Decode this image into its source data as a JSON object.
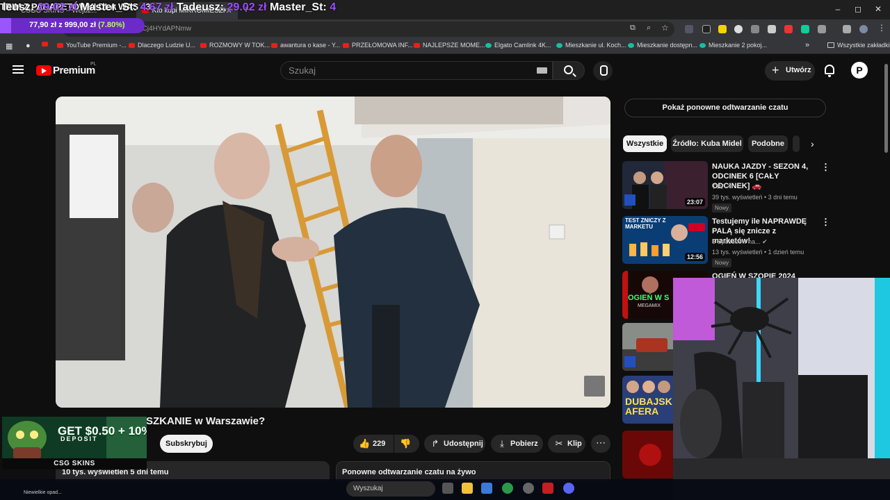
{
  "browser": {
    "tabs": [
      {
        "label": "CSGO SKINS – Wejdź...",
        "active": false
      },
      {
        "label": "Kto kupi MIKROMIESZKANIE",
        "active": true
      }
    ],
    "url": "youtube.com/watch?v=Cj4HYdAPNmw",
    "bookmarks": [
      "YouTube Premium -...",
      "Dlaczego Ludzie U...",
      "ROZMOWY W TOK...",
      "awantura o kase - Y...",
      "PRZEŁOMOWA INF...",
      "NAJLEPSZE MOME...",
      "Elgato Camlink 4K...",
      "Mieszkanie ul. Koch...",
      "Mieszkanie dostępn...",
      "Mieszkanie 2 pokoj..."
    ],
    "all_bookmarks": "Wszystkie zakładki"
  },
  "youtube": {
    "logo_text": "Premium",
    "logo_region": "PL",
    "search_placeholder": "Szukaj",
    "create_label": "Utwórz",
    "avatar_letter": "P"
  },
  "video": {
    "title_visible": "SZKANIE w Warszawie?",
    "subscribe_label": "Subskrybuj",
    "likes": "229",
    "share_label": "Udostępnij",
    "download_label": "Pobierz",
    "clip_label": "Klip",
    "views_date": "10 tys. wyświetleń  5 dni temu",
    "replay_box": "Ponowne odtwarzanie czatu na żywo"
  },
  "sidebar": {
    "chat_replay_button": "Pokaż ponowne odtwarzanie czatu",
    "chips": [
      "Wszystkie",
      "Źródło: Kuba Midel",
      "Podobne"
    ],
    "videos": [
      {
        "title": "NAUKA JAZDY - SEZON 4, ODCINEK 6 [CAŁY ODCINEK]",
        "channel": "TTV",
        "meta": "39 tys. wyświetleń • 3 dni temu",
        "badge": "Nowy",
        "duration": "23:07"
      },
      {
        "title": "Testujemy ile NAPRAWDĘ PALĄ się znicze z marketów!",
        "channel": "5 Sposobów na...",
        "meta": "13 tys. wyświetleń • 1 dzień temu",
        "badge": "Nowy",
        "duration": "12:56",
        "thumb_text": "TEST ZNICZY Z MARKETU"
      },
      {
        "title": "OGIEŃ W SZOPIE 2024 VOL.46",
        "thumb_text": "OGIEŃ W S",
        "thumb_sub": "MEGAMIX"
      },
      {
        "title": ""
      },
      {
        "title": "",
        "thumb_text": "DUBAJSK AFERA"
      },
      {
        "title": ""
      }
    ]
  },
  "overlay": {
    "top_text": "TRIM Z PARAPETÓWKI DLA WAS <3",
    "goal_text": "77,90 zł z 999,00 zł",
    "goal_pct_text": "(7.80%)",
    "goal_fraction": 0.078,
    "ad_text": "GET $0.50 + 10%",
    "ad_sub": "DEPOSIT",
    "ad_brand": "CSG SKINS",
    "ticker": [
      {
        "name": "leusz:",
        "amount": "29.02 zł"
      },
      {
        "name": "Master_St:",
        "amount": "4.67 zł"
      },
      {
        "name": "Tadeusz:",
        "amount": "29.02 zł"
      },
      {
        "name": "Master_St:",
        "amount": "4"
      }
    ],
    "weather_text": "Niewielkie opad...",
    "taskbar_search": "Wyszukaj"
  }
}
